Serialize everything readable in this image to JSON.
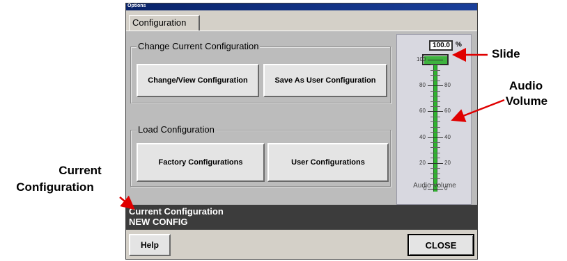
{
  "window": {
    "title": "Options"
  },
  "tabs": [
    {
      "label": "Configuration"
    }
  ],
  "change_group": {
    "label": "Change Current Configuration",
    "buttons": [
      {
        "label": "Change/View Configuration"
      },
      {
        "label": "Save As User Configuration"
      }
    ]
  },
  "load_group": {
    "label": "Load Configuration",
    "buttons": [
      {
        "label": "Factory Configurations"
      },
      {
        "label": "User Configurations"
      }
    ]
  },
  "volume": {
    "readout": "100.0",
    "unit": "%",
    "level_percent": 100,
    "scale_left": [
      "100",
      "80",
      "60",
      "40",
      "20",
      "0"
    ],
    "scale_right": [
      "80",
      "60",
      "40",
      "20",
      "0"
    ],
    "caption": "Audio Volume",
    "track_color": "#2fb52f"
  },
  "status": {
    "title": "Current Configuration",
    "value": "NEW CONFIG",
    "background": "#3c3c3c"
  },
  "footer": {
    "help_label": "Help",
    "close_label": "CLOSE"
  },
  "annotations": {
    "slide": "Slide",
    "audio_volume_line1": "Audio",
    "audio_volume_line2": "Volume",
    "current_config_line1": "Current",
    "current_config_line2": "Configuration",
    "arrow_color": "#e00000"
  }
}
